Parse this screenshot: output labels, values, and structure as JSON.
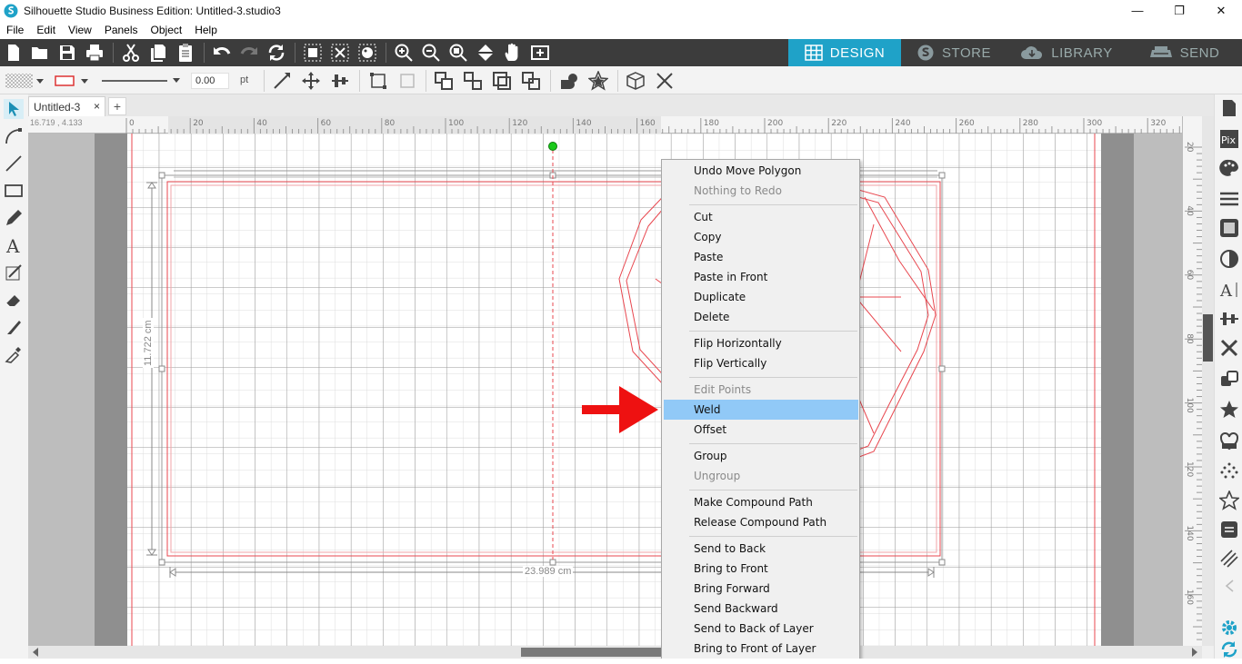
{
  "window": {
    "title": "Silhouette Studio Business Edition: Untitled-3.studio3",
    "minimize": "—",
    "restore": "❐",
    "close": "✕"
  },
  "menubar": [
    "File",
    "Edit",
    "View",
    "Panels",
    "Object",
    "Help"
  ],
  "top_tabs": [
    {
      "label": "DESIGN",
      "icon": "grid-icon",
      "active": true
    },
    {
      "label": "STORE",
      "icon": "silhouette-s-icon",
      "active": false
    },
    {
      "label": "LIBRARY",
      "icon": "cloud-icon",
      "active": false
    },
    {
      "label": "SEND",
      "icon": "cutter-icon",
      "active": false
    }
  ],
  "line_settings": {
    "width_value": "0.00",
    "unit": "pt"
  },
  "document": {
    "tab_label": "Untitled-3",
    "close": "×",
    "add": "+"
  },
  "cursor_coords": "16.719 , 4.133",
  "ruler_top_labels": [
    "0",
    "20",
    "40",
    "60",
    "80",
    "100",
    "120",
    "140",
    "160",
    "180",
    "200",
    "220",
    "240",
    "260",
    "280",
    "300",
    "320"
  ],
  "ruler_left_labels": [
    "20",
    "40",
    "60",
    "80",
    "100",
    "120",
    "140",
    "160"
  ],
  "dimensions": {
    "height": "11.722 cm",
    "width": "23.989 cm"
  },
  "context_menu": {
    "groups": [
      [
        {
          "label": "Undo Move Polygon",
          "enabled": true
        },
        {
          "label": "Nothing to Redo",
          "enabled": false
        }
      ],
      [
        {
          "label": "Cut",
          "enabled": true
        },
        {
          "label": "Copy",
          "enabled": true
        },
        {
          "label": "Paste",
          "enabled": true
        },
        {
          "label": "Paste in Front",
          "enabled": true
        },
        {
          "label": "Duplicate",
          "enabled": true
        },
        {
          "label": "Delete",
          "enabled": true
        }
      ],
      [
        {
          "label": "Flip Horizontally",
          "enabled": true
        },
        {
          "label": "Flip Vertically",
          "enabled": true
        }
      ],
      [
        {
          "label": "Edit Points",
          "enabled": false
        },
        {
          "label": "Weld",
          "enabled": true,
          "highlighted": true
        },
        {
          "label": "Offset",
          "enabled": true
        }
      ],
      [
        {
          "label": "Group",
          "enabled": true
        },
        {
          "label": "Ungroup",
          "enabled": false
        }
      ],
      [
        {
          "label": "Make Compound Path",
          "enabled": true
        },
        {
          "label": "Release Compound Path",
          "enabled": true
        }
      ],
      [
        {
          "label": "Send to Back",
          "enabled": true
        },
        {
          "label": "Bring to Front",
          "enabled": true
        },
        {
          "label": "Bring Forward",
          "enabled": true
        },
        {
          "label": "Send Backward",
          "enabled": true
        },
        {
          "label": "Send to Back of Layer",
          "enabled": true
        },
        {
          "label": "Bring to Front of Layer",
          "enabled": true
        }
      ]
    ]
  },
  "colors": {
    "accent": "#1fa2c8",
    "toolbar": "#3c3c3c",
    "cut_line": "#e8474f",
    "highlight": "#91c9f7",
    "arrow": "#ee1111"
  }
}
